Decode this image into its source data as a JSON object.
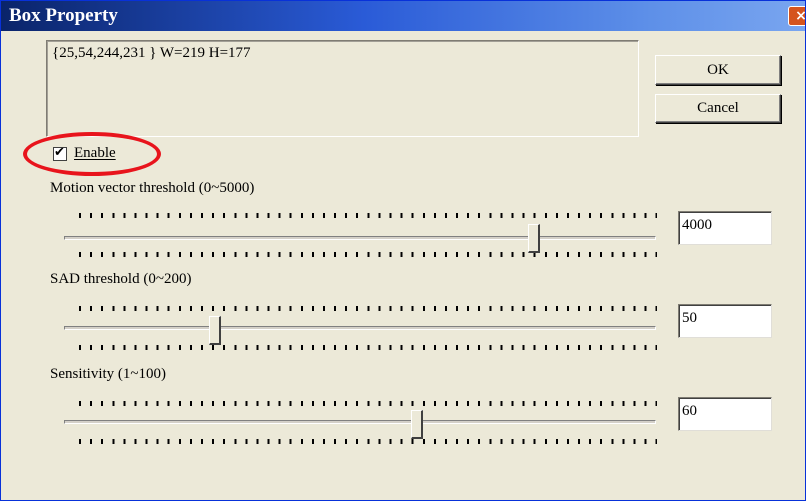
{
  "window": {
    "title": "Box Property",
    "close_glyph": "×"
  },
  "info_text": "{25,54,244,231 } W=219 H=177",
  "buttons": {
    "ok": "OK",
    "cancel": "Cancel"
  },
  "enable": {
    "label": "Enable",
    "checked": true,
    "check_glyph": "✔"
  },
  "sliders": [
    {
      "label": "Motion vector threshold (0~5000)",
      "value": "4000",
      "min": 0,
      "max": 5000
    },
    {
      "label": "SAD threshold (0~200)",
      "value": "50",
      "min": 0,
      "max": 200
    },
    {
      "label": "Sensitivity (1~100)",
      "value": "60",
      "min": 1,
      "max": 100
    }
  ],
  "colors": {
    "highlight": "#e8141c",
    "titlebar": "#0a246a",
    "dialog_bg": "#ece9d8"
  }
}
